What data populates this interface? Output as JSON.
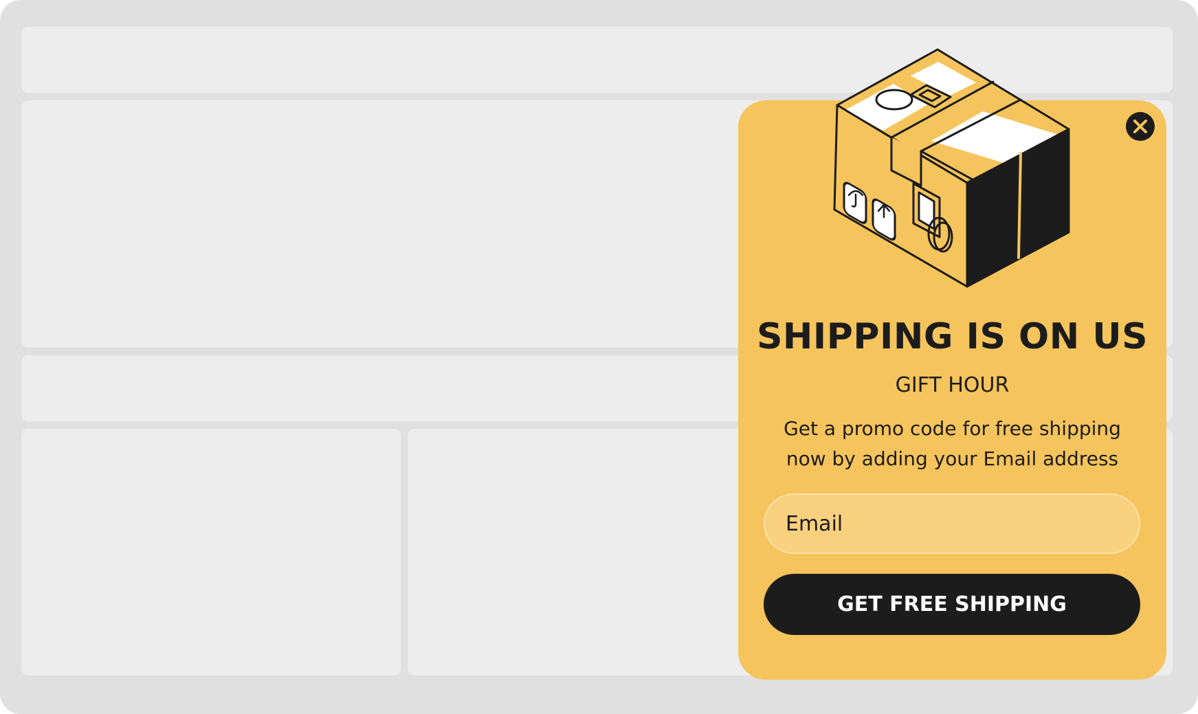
{
  "popup": {
    "title": "SHIPPING IS ON US",
    "subtitle": "GIFT HOUR",
    "description_lines": [
      "Get a promo code for free shipping",
      "now by adding your Email address"
    ],
    "email_placeholder": "Email",
    "email_value": "",
    "cta_label": "GET FREE SHIPPING",
    "illustration": "shipping-box",
    "close_icon": "close-icon"
  },
  "colors": {
    "page_background": "#e0e0e0",
    "placeholder_block": "#ededed",
    "popup_background": "#f6c45c",
    "input_background": "#f8d07e",
    "dark": "#1c1c1c",
    "button_text": "#ffffff"
  }
}
